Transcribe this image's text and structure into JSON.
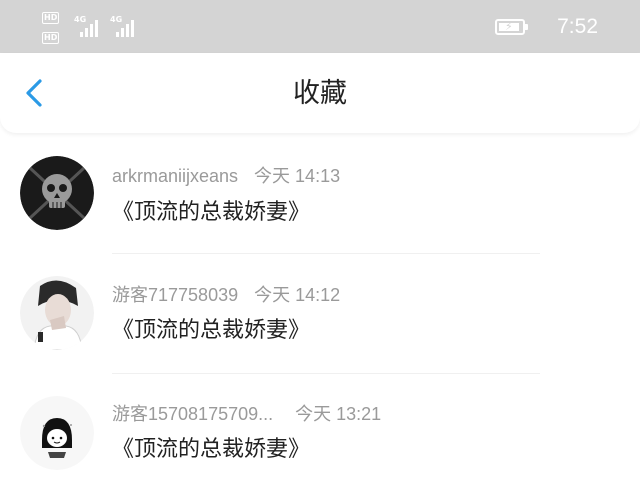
{
  "status_bar": {
    "hd_1": "HD",
    "hd_2": "HD",
    "signal_1_label": "4G",
    "signal_2_label": "4G",
    "time": "7:52",
    "icons": [
      "hd-icon",
      "signal-4g-icon",
      "battery-charging-icon"
    ]
  },
  "header": {
    "back_icon": "chevron-left-icon",
    "title": "收藏",
    "accent_color": "#2b9ae6"
  },
  "favorites": [
    {
      "user": "arkrmaniijxeans",
      "time": "今天 14:13",
      "title": "《顶流的总裁娇妻》",
      "avatar": "skull-avatar"
    },
    {
      "user": "游客717758039",
      "time": "今天 14:12",
      "title": "《顶流的总裁娇妻》",
      "avatar": "photo-avatar"
    },
    {
      "user": "游客15708175709...",
      "time": "今天 13:21",
      "title": "《顶流的总裁娇妻》",
      "avatar": "cartoon-girl-avatar"
    }
  ]
}
